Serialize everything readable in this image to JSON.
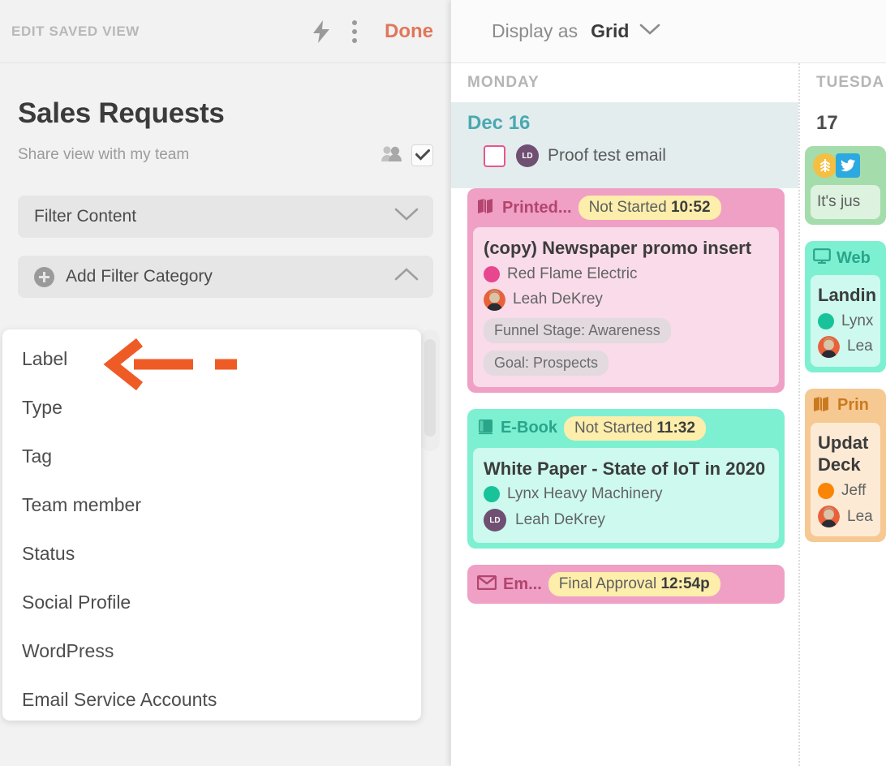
{
  "sidebar": {
    "header": {
      "title": "EDIT SAVED VIEW",
      "bolt_icon": "lightning-bolt-icon",
      "menu_icon": "kebab-menu-icon",
      "done_label": "Done"
    },
    "view_name": "Sales Requests",
    "share": {
      "label": "Share view with my team",
      "people_icon": "people-icon",
      "checked": true
    },
    "filter_content": {
      "label": "Filter Content",
      "chevron": "chevron-down-icon"
    },
    "add_filter_category": {
      "label": "Add Filter Category",
      "plus_icon": "plus-circle-icon",
      "chevron": "chevron-up-icon"
    },
    "dropdown_items": [
      {
        "label": "Label"
      },
      {
        "label": "Type"
      },
      {
        "label": "Tag"
      },
      {
        "label": "Team member"
      },
      {
        "label": "Status"
      },
      {
        "label": "Social Profile"
      },
      {
        "label": "WordPress"
      },
      {
        "label": "Email Service Accounts"
      }
    ],
    "annotation": {
      "type": "arrow-left",
      "color": "#ef5b25",
      "target": "Label"
    }
  },
  "calendar": {
    "toolbar": {
      "display_label": "Display as",
      "display_value": "Grid",
      "chevron": "chevron-down-icon"
    },
    "columns": [
      {
        "dayname": "MONDAY",
        "daynum": "Dec 16",
        "todo": {
          "text": "Proof test email",
          "avatar_initials": "LD",
          "checked": false
        },
        "cards": [
          {
            "type": "Printed...",
            "type_icon": "brochure-icon",
            "status": "Not Started",
            "time": "10:52",
            "title": "(copy) Newspaper promo insert",
            "brand": "Red Flame Electric",
            "brand_color": "#e8468f",
            "person": "Leah DeKrey",
            "avatar": "photo",
            "tags": [
              "Funnel Stage: Awareness",
              "Goal: Prospects"
            ],
            "header_bg": "#efa0c4",
            "body_bg": "#fce4ef",
            "type_color": "#b3456e"
          },
          {
            "type": "E-Book",
            "type_icon": "book-icon",
            "status": "Not Started",
            "time": "11:32",
            "title": "White Paper - State of IoT in 2020",
            "brand": "Lynx Heavy Machinery",
            "brand_color": "#18c39a",
            "person": "Leah DeKrey",
            "avatar": "initials",
            "avatar_initials": "LD",
            "tags": [],
            "header_bg": "#7df0d2",
            "body_bg": "#e1fbf4",
            "type_color": "#2aa58a"
          },
          {
            "type": "Em...",
            "type_icon": "envelope-icon",
            "status": "Final Approval",
            "time": "12:54p",
            "title": "",
            "header_bg": "#efa0c4",
            "body_bg": "#fce4ef",
            "type_color": "#b3456e"
          }
        ]
      },
      {
        "dayname": "TUESDA",
        "daynum": "17",
        "cards": [
          {
            "type": "",
            "type_icon": "social-icons",
            "social_icons": [
              "wheat-icon",
              "twitter-icon"
            ],
            "body_text": "It's jus",
            "header_bg": "#a5dcab",
            "body_bg": "#eaf8ec"
          },
          {
            "type": "Web",
            "type_icon": "monitor-icon",
            "title": "Landin",
            "brand": "Lynx",
            "brand_color": "#18c39a",
            "person": "Lea",
            "avatar": "photo",
            "header_bg": "#7df0d2",
            "body_bg": "#e1fbf4",
            "type_color": "#2aa58a"
          },
          {
            "type": "Prin",
            "type_icon": "brochure-icon",
            "title": "Updat Deck",
            "brand": "Jeff",
            "brand_color": "#f98503",
            "person": "Lea",
            "avatar": "photo",
            "header_bg": "#f6c892",
            "body_bg": "#fcf1e3",
            "type_color": "#c97a1f"
          }
        ]
      }
    ]
  }
}
